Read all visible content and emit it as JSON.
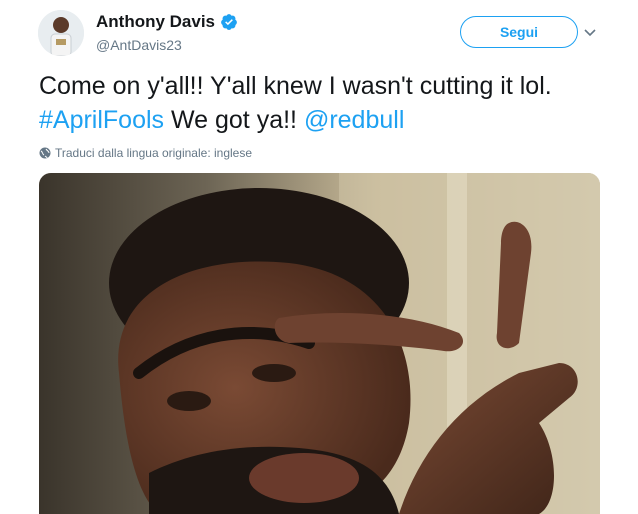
{
  "tweet": {
    "display_name": "Anthony Davis",
    "handle": "@AntDavis23",
    "follow_label": "Segui",
    "text_part1": "Come on y'all!! Y'all knew I wasn't cutting it lol.  ",
    "hashtag": "#AprilFools",
    "text_part2": " We got ya!! ",
    "mention": "@redbull",
    "translate_label": "Traduci dalla lingua originale: inglese"
  },
  "icons": {
    "verified": "verified-badge-icon",
    "caret": "chevron-down-icon",
    "globe": "globe-icon"
  },
  "colors": {
    "accent": "#1da1f2",
    "text": "#14171a",
    "muted": "#657786"
  }
}
